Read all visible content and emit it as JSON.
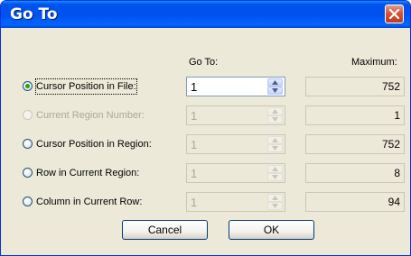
{
  "dialog": {
    "title": "Go To",
    "headers": {
      "goto": "Go To:",
      "maximum": "Maximum:"
    },
    "rows": [
      {
        "label": "Cursor Position in File:",
        "value": "1",
        "maximum": "752",
        "selected": true,
        "enabled": true
      },
      {
        "label": "Current Region Number:",
        "value": "1",
        "maximum": "1",
        "selected": false,
        "enabled": false
      },
      {
        "label": "Cursor Position in Region:",
        "value": "1",
        "maximum": "752",
        "selected": false,
        "enabled": true
      },
      {
        "label": "Row in Current Region:",
        "value": "1",
        "maximum": "8",
        "selected": false,
        "enabled": true
      },
      {
        "label": "Column in Current Row:",
        "value": "1",
        "maximum": "94",
        "selected": false,
        "enabled": true
      }
    ],
    "buttons": {
      "cancel": "Cancel",
      "ok": "OK"
    }
  },
  "colors": {
    "title_bar": "#0054e3",
    "close_button": "#d5553a",
    "face": "#ece9d8",
    "radio_checked": "#21a121"
  }
}
